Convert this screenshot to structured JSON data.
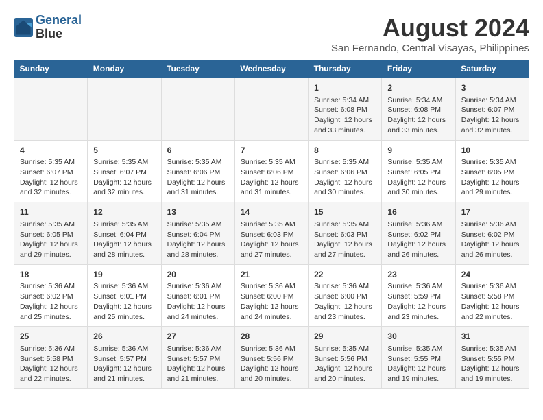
{
  "header": {
    "logo_line1": "General",
    "logo_line2": "Blue",
    "title": "August 2024",
    "subtitle": "San Fernando, Central Visayas, Philippines"
  },
  "days_of_week": [
    "Sunday",
    "Monday",
    "Tuesday",
    "Wednesday",
    "Thursday",
    "Friday",
    "Saturday"
  ],
  "weeks": [
    [
      {
        "day": "",
        "info": ""
      },
      {
        "day": "",
        "info": ""
      },
      {
        "day": "",
        "info": ""
      },
      {
        "day": "",
        "info": ""
      },
      {
        "day": "1",
        "info": "Sunrise: 5:34 AM\nSunset: 6:08 PM\nDaylight: 12 hours and 33 minutes."
      },
      {
        "day": "2",
        "info": "Sunrise: 5:34 AM\nSunset: 6:08 PM\nDaylight: 12 hours and 33 minutes."
      },
      {
        "day": "3",
        "info": "Sunrise: 5:34 AM\nSunset: 6:07 PM\nDaylight: 12 hours and 32 minutes."
      }
    ],
    [
      {
        "day": "4",
        "info": "Sunrise: 5:35 AM\nSunset: 6:07 PM\nDaylight: 12 hours and 32 minutes."
      },
      {
        "day": "5",
        "info": "Sunrise: 5:35 AM\nSunset: 6:07 PM\nDaylight: 12 hours and 32 minutes."
      },
      {
        "day": "6",
        "info": "Sunrise: 5:35 AM\nSunset: 6:06 PM\nDaylight: 12 hours and 31 minutes."
      },
      {
        "day": "7",
        "info": "Sunrise: 5:35 AM\nSunset: 6:06 PM\nDaylight: 12 hours and 31 minutes."
      },
      {
        "day": "8",
        "info": "Sunrise: 5:35 AM\nSunset: 6:06 PM\nDaylight: 12 hours and 30 minutes."
      },
      {
        "day": "9",
        "info": "Sunrise: 5:35 AM\nSunset: 6:05 PM\nDaylight: 12 hours and 30 minutes."
      },
      {
        "day": "10",
        "info": "Sunrise: 5:35 AM\nSunset: 6:05 PM\nDaylight: 12 hours and 29 minutes."
      }
    ],
    [
      {
        "day": "11",
        "info": "Sunrise: 5:35 AM\nSunset: 6:05 PM\nDaylight: 12 hours and 29 minutes."
      },
      {
        "day": "12",
        "info": "Sunrise: 5:35 AM\nSunset: 6:04 PM\nDaylight: 12 hours and 28 minutes."
      },
      {
        "day": "13",
        "info": "Sunrise: 5:35 AM\nSunset: 6:04 PM\nDaylight: 12 hours and 28 minutes."
      },
      {
        "day": "14",
        "info": "Sunrise: 5:35 AM\nSunset: 6:03 PM\nDaylight: 12 hours and 27 minutes."
      },
      {
        "day": "15",
        "info": "Sunrise: 5:35 AM\nSunset: 6:03 PM\nDaylight: 12 hours and 27 minutes."
      },
      {
        "day": "16",
        "info": "Sunrise: 5:36 AM\nSunset: 6:02 PM\nDaylight: 12 hours and 26 minutes."
      },
      {
        "day": "17",
        "info": "Sunrise: 5:36 AM\nSunset: 6:02 PM\nDaylight: 12 hours and 26 minutes."
      }
    ],
    [
      {
        "day": "18",
        "info": "Sunrise: 5:36 AM\nSunset: 6:02 PM\nDaylight: 12 hours and 25 minutes."
      },
      {
        "day": "19",
        "info": "Sunrise: 5:36 AM\nSunset: 6:01 PM\nDaylight: 12 hours and 25 minutes."
      },
      {
        "day": "20",
        "info": "Sunrise: 5:36 AM\nSunset: 6:01 PM\nDaylight: 12 hours and 24 minutes."
      },
      {
        "day": "21",
        "info": "Sunrise: 5:36 AM\nSunset: 6:00 PM\nDaylight: 12 hours and 24 minutes."
      },
      {
        "day": "22",
        "info": "Sunrise: 5:36 AM\nSunset: 6:00 PM\nDaylight: 12 hours and 23 minutes."
      },
      {
        "day": "23",
        "info": "Sunrise: 5:36 AM\nSunset: 5:59 PM\nDaylight: 12 hours and 23 minutes."
      },
      {
        "day": "24",
        "info": "Sunrise: 5:36 AM\nSunset: 5:58 PM\nDaylight: 12 hours and 22 minutes."
      }
    ],
    [
      {
        "day": "25",
        "info": "Sunrise: 5:36 AM\nSunset: 5:58 PM\nDaylight: 12 hours and 22 minutes."
      },
      {
        "day": "26",
        "info": "Sunrise: 5:36 AM\nSunset: 5:57 PM\nDaylight: 12 hours and 21 minutes."
      },
      {
        "day": "27",
        "info": "Sunrise: 5:36 AM\nSunset: 5:57 PM\nDaylight: 12 hours and 21 minutes."
      },
      {
        "day": "28",
        "info": "Sunrise: 5:36 AM\nSunset: 5:56 PM\nDaylight: 12 hours and 20 minutes."
      },
      {
        "day": "29",
        "info": "Sunrise: 5:35 AM\nSunset: 5:56 PM\nDaylight: 12 hours and 20 minutes."
      },
      {
        "day": "30",
        "info": "Sunrise: 5:35 AM\nSunset: 5:55 PM\nDaylight: 12 hours and 19 minutes."
      },
      {
        "day": "31",
        "info": "Sunrise: 5:35 AM\nSunset: 5:55 PM\nDaylight: 12 hours and 19 minutes."
      }
    ]
  ]
}
